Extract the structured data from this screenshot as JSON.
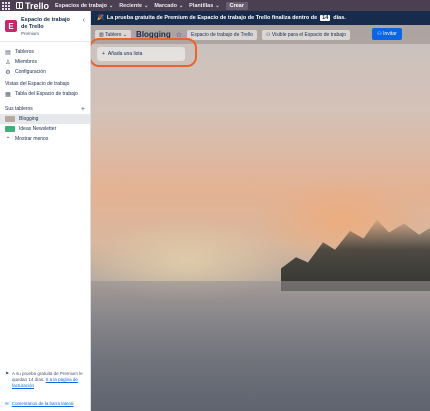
{
  "topnav": {
    "app_name": "Trello",
    "items": [
      {
        "label": "Espacios de trabajo"
      },
      {
        "label": "Reciente"
      },
      {
        "label": "Marcado"
      },
      {
        "label": "Plantillas"
      }
    ],
    "create_label": "Crear"
  },
  "sidebar": {
    "workspace": {
      "initial": "E",
      "name": "Espacio de trabajo de Trello",
      "plan": "Premium"
    },
    "items": [
      {
        "label": "Tableros",
        "icon": "board-icon"
      },
      {
        "label": "Miembros",
        "icon": "members-icon"
      },
      {
        "label": "Configuración",
        "icon": "settings-icon"
      }
    ],
    "views_heading": "Vistas del Espacio de trabajo",
    "views": [
      {
        "label": "Tabla del Espacio de trabajo",
        "icon": "table-icon"
      }
    ],
    "boards_heading": "Sus tableros",
    "boards": [
      {
        "label": "Blogging",
        "color": "#b8a89e"
      },
      {
        "label": "Ideas Newsletter",
        "color": "#3bb37a"
      }
    ],
    "show_less": "Mostrar menos",
    "trial_note": "A su prueba gratuita de Premium le quedan 14 días.",
    "billing_link": "Ir a la página de facturación",
    "feedback_link": "Comentarios de la barra lateral"
  },
  "banner": {
    "text_before": "La prueba gratuita de Premium de Espacio de trabajo de Trello finaliza dentro de",
    "days": "14",
    "text_after": "días."
  },
  "boardbar": {
    "view_label": "Tablero",
    "title": "Blogging",
    "workspace_label": "Espacio de trabajo de Trello",
    "visibility_label": "Visible para el Espacio de trabajo",
    "invite_label": "Invitar"
  },
  "board": {
    "add_list_label": "Añada una lista"
  },
  "colors": {
    "topnav": "#4b3f52",
    "accent": "#0c66e4",
    "highlight": "#e8642c",
    "workspace_avatar": "#c9266b"
  }
}
